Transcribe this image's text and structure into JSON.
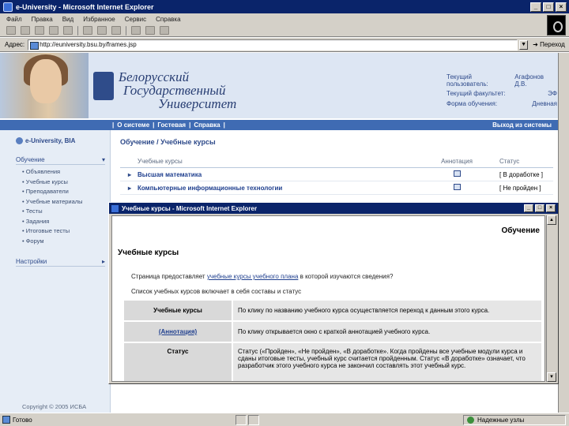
{
  "window": {
    "title": "e-University - Microsoft Internet Explorer"
  },
  "menu": [
    "Файл",
    "Правка",
    "Вид",
    "Избранное",
    "Сервис",
    "Справка"
  ],
  "address": {
    "label": "Адрес:",
    "url": "http://euniversity.bsu.by/frames.jsp",
    "go": "Переход"
  },
  "banner": {
    "university": [
      "Белорусский",
      "Государственный",
      "Университет"
    ],
    "user_rows": [
      {
        "label": "Текущий пользователь:",
        "value": "Агафонов Д.В."
      },
      {
        "label": "Текущий факультет:",
        "value": "ЭФ"
      },
      {
        "label": "Форма обучения:",
        "value": "Дневная"
      }
    ]
  },
  "nav": {
    "about": "О системе",
    "guest": "Гостевая",
    "help": "Справка",
    "logout": "Выход из системы",
    "sep": "|"
  },
  "sidebar": {
    "brand": "e-University, BIA",
    "section1": "Обучение",
    "items": [
      "Объявления",
      "Учебные курсы",
      "Преподаватели",
      "Учебные материалы",
      "Тесты",
      "Задания",
      "Итоговые тесты",
      "Форум"
    ],
    "section2": "Настройки",
    "copyright": "Copyright © 2005 ИСБА"
  },
  "main": {
    "breadcrumb": "Обучение / Учебные курсы",
    "col_course": "Учебные курсы",
    "col_annotation": "Аннотация",
    "col_status": "Статус",
    "rows": [
      {
        "course": "Высшая математика",
        "status": "[ В доработке ]"
      },
      {
        "course": "Компьютерные информационные технологии",
        "status": "[ Не пройден ]"
      }
    ]
  },
  "popup": {
    "title": "Учебные курсы - Microsoft Internet Explorer",
    "header": "Обучение",
    "heading": "Учебные курсы",
    "line1_pre": "Страница предоставляет ",
    "line1_link": "учебные курсы учебного плана",
    "line1_post": " в которой изучаются сведения?",
    "line2": "Список учебных курсов включает в себя составы и статус",
    "rows": [
      {
        "key": "Учебные курсы",
        "value": "По клику по названию учебного курса осуществляется переход к данным этого курса."
      },
      {
        "key": "(Аннотация)",
        "value": "По клику открывается окно с краткой аннотацией учебного курса."
      },
      {
        "key": "Статус",
        "value": "Статус («Пройден», «Не пройден», «В доработке». Когда пройдены все учебные модули курса и сданы итоговые тесты, учебный курс считается пройденным. Статус «В доработке» означает, что разработчик этого учебного курса не закончил составлять этот учебный курс."
      }
    ]
  },
  "status": {
    "text": "Готово",
    "zone": "Надежные узлы"
  }
}
